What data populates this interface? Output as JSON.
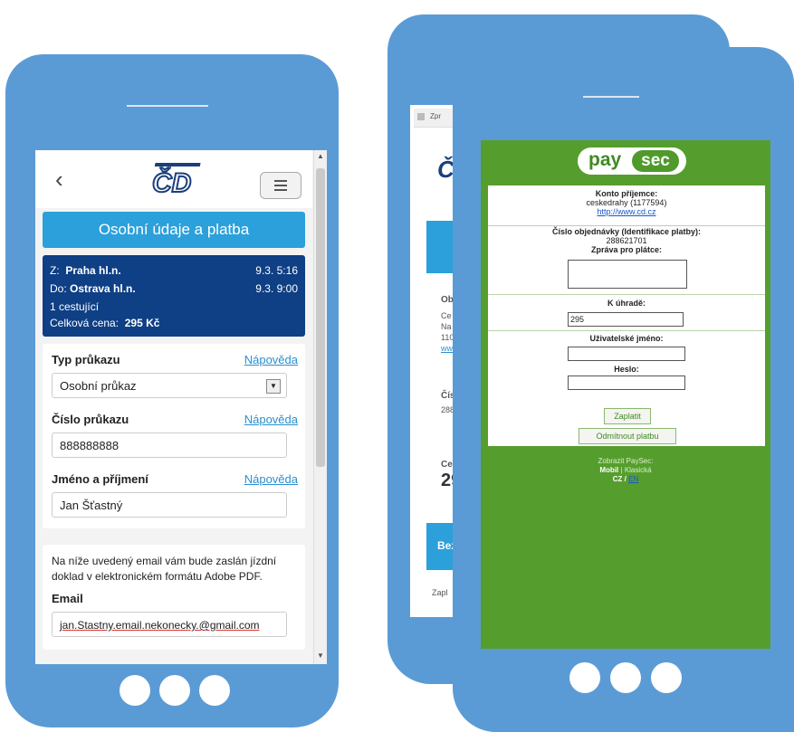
{
  "left": {
    "header": {
      "back_icon": "chevron-left-icon",
      "logo_text": "ČD",
      "menu_icon": "hamburger-icon"
    },
    "title": "Osobní údaje a platba",
    "trip": {
      "from_label": "Z:",
      "from_station": "Praha hl.n.",
      "from_time": "9.3. 5:16",
      "to_label": "Do:",
      "to_station": "Ostrava hl.n.",
      "to_time": "9.3. 9:00",
      "passengers": "1 cestující",
      "total_label": "Celková cena:",
      "total_value": "295 Kč"
    },
    "form": {
      "card_type_label": "Typ průkazu",
      "card_type_value": "Osobní průkaz",
      "card_number_label": "Číslo průkazu",
      "card_number_value": "888888888",
      "name_label": "Jméno a příjmení",
      "name_value": "Jan Šťastný",
      "help_link": "Nápověda"
    },
    "email": {
      "note": "Na níže uvedený email vám bude zaslán jízdní doklad v elektronickém formátu Adobe PDF.",
      "label": "Email",
      "value": "jan.Stastny.email.nekonecky.@gmail.com"
    }
  },
  "back": {
    "tab_text": "Zpr",
    "logo_partial": "ČS",
    "snippet_ob": "Ob",
    "snippet_ce": "Ce",
    "snippet_na": "Na",
    "snippet_11": "110",
    "snippet_ww": "www",
    "snippet_cis": "Čís",
    "snippet_288": "288",
    "snippet_ce2": "Ce",
    "snippet_29": "29",
    "snippet_bez": "Bez",
    "snippet_zap": "Zapl"
  },
  "paysec": {
    "logo_pay": "pay",
    "logo_sec": "sec",
    "recipient_label": "Konto příjemce:",
    "recipient_name": "ceskedrahy (1177594)",
    "recipient_url": "http://www.cd.cz",
    "order_label": "Číslo objednávky (Identifikace platby):",
    "order_value": "288621701",
    "message_label": "Zpráva pro plátce:",
    "amount_label": "K úhradě:",
    "amount_value": "295",
    "username_label": "Uživatelské jméno:",
    "password_label": "Heslo:",
    "pay_button": "Zaplatit",
    "reject_button": "Odmítnout platbu",
    "footer_line1": "Zobrazit PaySec:",
    "footer_mobile": "Mobil",
    "footer_sep": "|",
    "footer_classic": "Klasická",
    "footer_cz": "CZ",
    "footer_slash": "/",
    "footer_en": "EN"
  }
}
